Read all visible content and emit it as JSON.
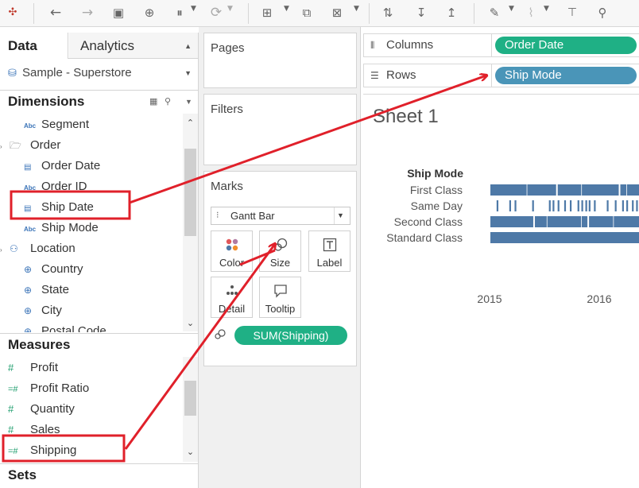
{
  "data_pane": {
    "tab_data": "Data",
    "tab_analytics": "Analytics",
    "datasource": "Sample - Superstore",
    "dimensions_header": "Dimensions",
    "measures_header": "Measures",
    "sets_header": "Sets",
    "dimensions": [
      {
        "label": "Segment",
        "icon": "abc-icon"
      },
      {
        "label": "Order",
        "icon": "folder-icon"
      },
      {
        "label": "Order Date",
        "icon": "calendar-icon"
      },
      {
        "label": "Order ID",
        "icon": "abc-icon"
      },
      {
        "label": "Ship Date",
        "icon": "calendar-icon"
      },
      {
        "label": "Ship Mode",
        "icon": "abc-icon"
      },
      {
        "label": "Location",
        "icon": "hierarchy-icon"
      },
      {
        "label": "Country",
        "icon": "globe-icon"
      },
      {
        "label": "State",
        "icon": "globe-icon"
      },
      {
        "label": "City",
        "icon": "globe-icon"
      },
      {
        "label": "Postal Code",
        "icon": "globe-icon"
      }
    ],
    "measures": [
      {
        "label": "Profit",
        "icon": "measure-icon"
      },
      {
        "label": "Profit Ratio",
        "icon": "calc-measure-icon"
      },
      {
        "label": "Quantity",
        "icon": "measure-icon"
      },
      {
        "label": "Sales",
        "icon": "measure-icon"
      },
      {
        "label": "Shipping",
        "icon": "calc-measure-icon"
      }
    ]
  },
  "cards": {
    "pages": "Pages",
    "filters": "Filters",
    "marks": "Marks",
    "mark_type": "Gantt Bar",
    "color": "Color",
    "size": "Size",
    "label": "Label",
    "detail": "Detail",
    "tooltip": "Tooltip",
    "size_pill": "SUM(Shipping)"
  },
  "shelves": {
    "columns_label": "Columns",
    "rows_label": "Rows",
    "columns_pill": "Order Date",
    "rows_pill": "Ship Mode"
  },
  "sheet": {
    "title": "Sheet 1"
  },
  "colors": {
    "green_pill": "#1fb085",
    "blue_pill": "#4a95b8",
    "bar": "#4e79a7",
    "annotation": "#e0202a"
  },
  "chart_data": {
    "type": "gantt",
    "row_header": "Ship Mode",
    "categories": [
      "First Class",
      "Same Day",
      "Second Class",
      "Standard Class"
    ],
    "x_ticks": [
      "2015",
      "2016"
    ],
    "coverage": [
      0.8,
      0.35,
      0.95,
      1.0
    ]
  }
}
